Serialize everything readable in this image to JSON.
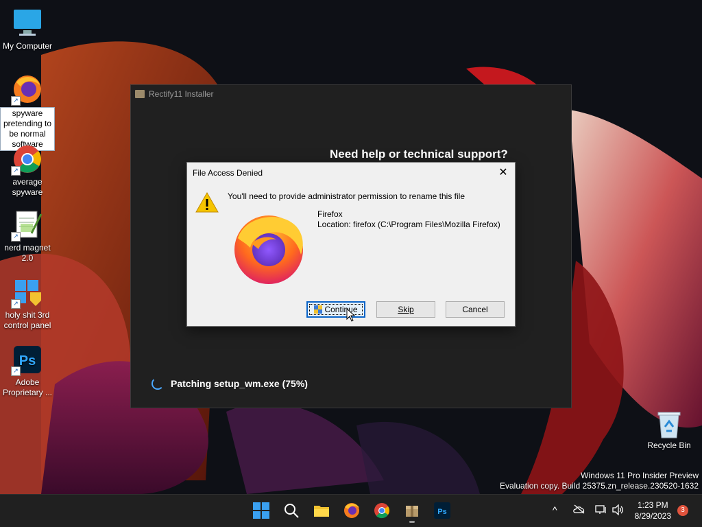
{
  "desktop": {
    "icons": [
      {
        "label": "My Computer"
      },
      {
        "label": "spyware pretending to be normal software"
      },
      {
        "label": "average spyware"
      },
      {
        "label": "nerd magnet 2.0"
      },
      {
        "label": "holy shit 3rd control panel"
      },
      {
        "label": "Adobe Proprietary ..."
      }
    ],
    "recycle_bin": "Recycle Bin"
  },
  "installer": {
    "title": "Rectify11 Installer",
    "help_text": "Need help or technical support?",
    "progress_text": "Patching setup_wm.exe (75%)",
    "progress_percent": 75
  },
  "dialog": {
    "title": "File Access Denied",
    "close_glyph": "✕",
    "message": "You'll need to provide administrator permission to rename this file",
    "file_name": "Firefox",
    "file_location": "Location: firefox (C:\\Program Files\\Mozilla Firefox)",
    "buttons": {
      "continue": "Continue",
      "skip": "Skip",
      "cancel": "Cancel"
    }
  },
  "watermark": {
    "line1": "Windows 11 Pro Insider Preview",
    "line2": "Evaluation copy. Build 25375.zn_release.230520-1632"
  },
  "taskbar": {
    "time": "1:23 PM",
    "date": "8/29/2023",
    "notification_count": "3",
    "chevron_glyph": "^"
  },
  "colors": {
    "accent": "#0a64c8",
    "taskbar": "#202020",
    "installer_bg": "#202020",
    "dialog_bg": "#f0f0f0"
  }
}
